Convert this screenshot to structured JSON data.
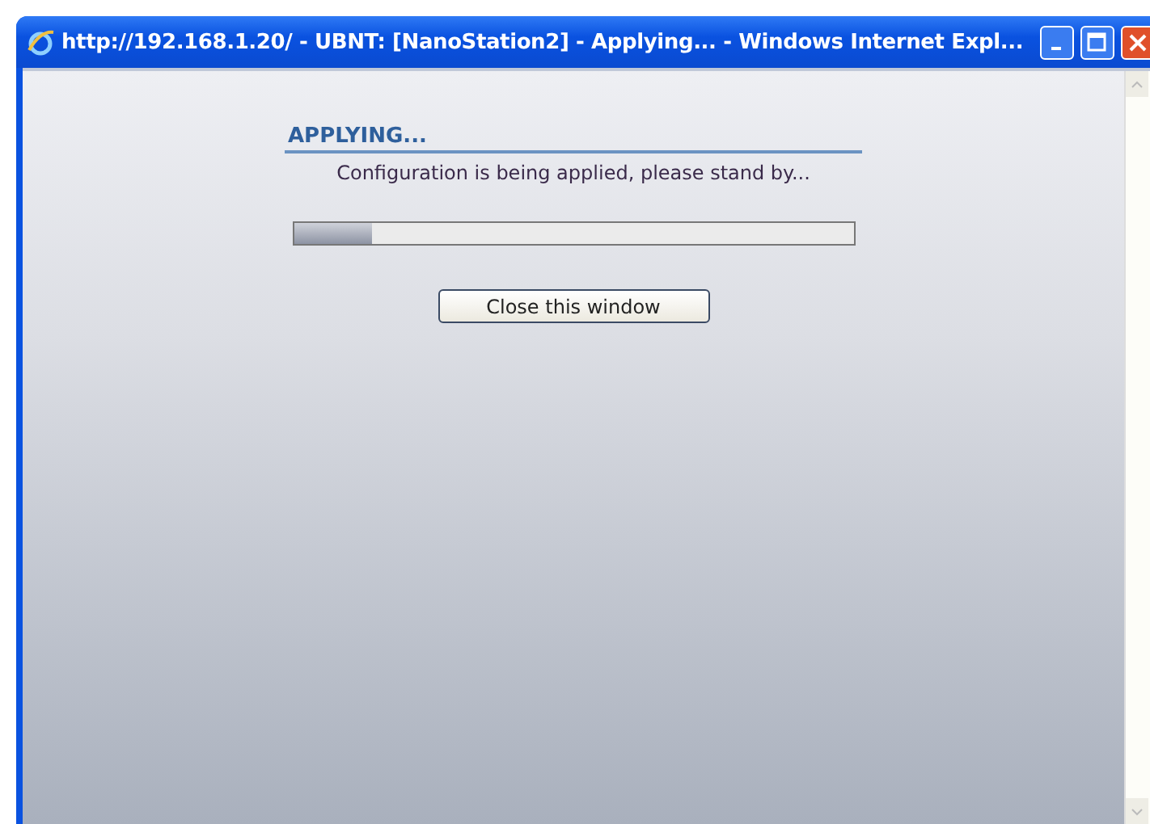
{
  "window": {
    "title": "http://192.168.1.20/ - UBNT: [NanoStation2] - Applying... - Windows Internet Expl..."
  },
  "dialog": {
    "heading": "APPLYING...",
    "message": "Configuration is being applied, please stand by...",
    "progress": {
      "level": 0.14
    },
    "button": "Close this window"
  }
}
